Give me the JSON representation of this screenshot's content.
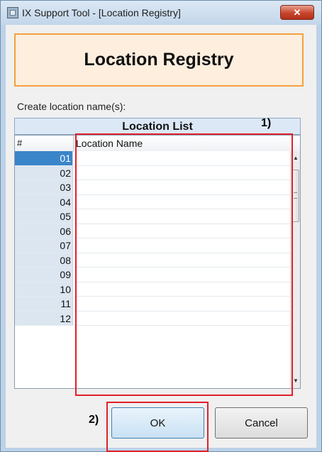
{
  "window": {
    "title": "IX Support Tool - [Location Registry]",
    "close_label": "✕"
  },
  "header": {
    "title": "Location Registry"
  },
  "create_label": "Create location name(s):",
  "list": {
    "caption": "Location List",
    "columns": [
      "#",
      "Location Name"
    ],
    "rows": [
      {
        "num": "01",
        "name": "",
        "selected": true
      },
      {
        "num": "02",
        "name": ""
      },
      {
        "num": "03",
        "name": ""
      },
      {
        "num": "04",
        "name": ""
      },
      {
        "num": "05",
        "name": ""
      },
      {
        "num": "06",
        "name": ""
      },
      {
        "num": "07",
        "name": ""
      },
      {
        "num": "08",
        "name": ""
      },
      {
        "num": "09",
        "name": ""
      },
      {
        "num": "10",
        "name": ""
      },
      {
        "num": "11",
        "name": ""
      },
      {
        "num": "12",
        "name": ""
      }
    ]
  },
  "annotations": {
    "one": "1)",
    "two": "2)"
  },
  "buttons": {
    "ok": "OK",
    "cancel": "Cancel"
  },
  "colors": {
    "accent_border": "#f5a03c",
    "highlight": "#e0202a",
    "selected_row": "#3a85c9"
  }
}
